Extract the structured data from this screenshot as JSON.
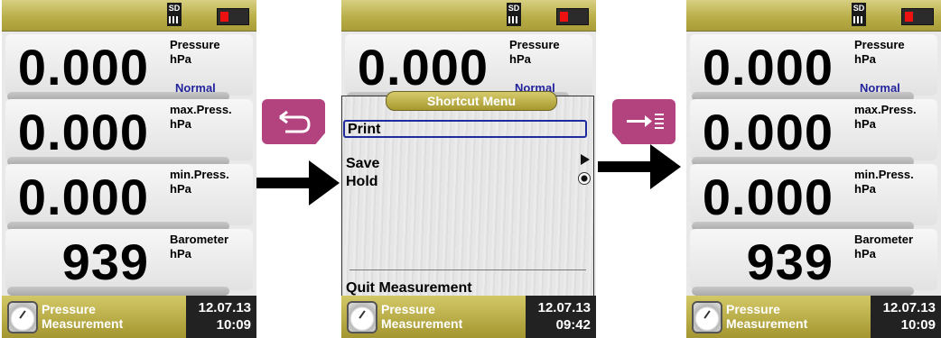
{
  "rows_left": [
    {
      "value": "0.000",
      "label": "Pressure",
      "unit": "hPa",
      "mode": "Normal"
    },
    {
      "value": "0.000",
      "label": "max.Press.",
      "unit": "hPa"
    },
    {
      "value": "0.000",
      "label": "min.Press.",
      "unit": "hPa"
    },
    {
      "value": "939",
      "label": "Barometer",
      "unit": "hPa"
    }
  ],
  "status": {
    "sd_label": "SD"
  },
  "bottom": {
    "title_line1": "Pressure",
    "title_line2": "Measurement",
    "date": "12.07.13",
    "time_left": "10:09",
    "time_mid": "09:42",
    "time_right": "10:09"
  },
  "menu": {
    "title": "Shortcut Menu",
    "items": [
      "Print",
      "Save",
      "Hold"
    ],
    "quit": "Quit Measurement"
  },
  "colors": {
    "key": "#b3437f",
    "bar": "#b7ac45",
    "mode_text": "#23239c"
  },
  "icons": {
    "back_key": "return-arrow-icon",
    "forward_key": "arrow-lines-icon"
  }
}
